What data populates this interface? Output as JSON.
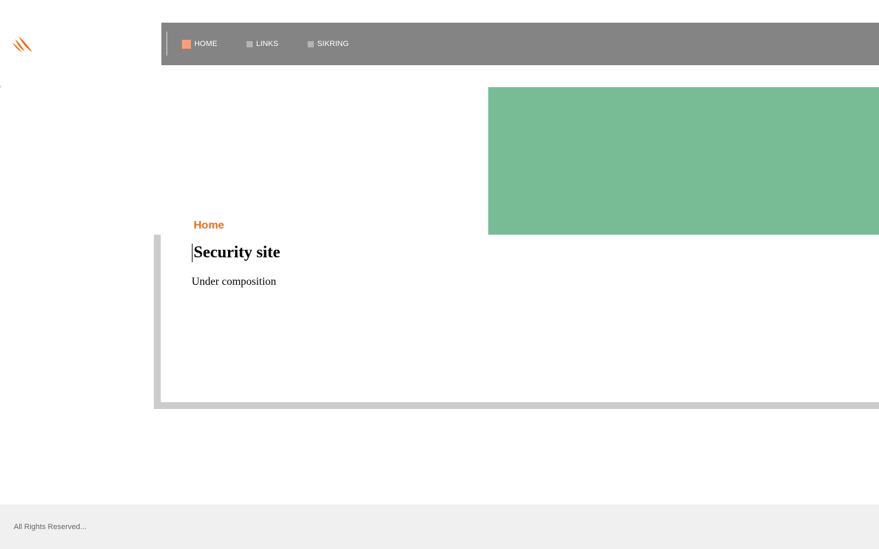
{
  "nav": {
    "items": [
      {
        "label": "HOME",
        "active": true
      },
      {
        "label": "LINKS",
        "active": false
      },
      {
        "label": "SIKRING",
        "active": false
      }
    ]
  },
  "main": {
    "section_title": "Home",
    "heading": "Security site",
    "body_text": "Under composition"
  },
  "footer": {
    "text": "All Rights Reserved..."
  },
  "colors": {
    "nav_background": "#848484",
    "accent_orange": "#f26b16",
    "active_bullet": "#fc9e7c",
    "banner_green": "#78bc96",
    "frame_gray": "#cccccc",
    "footer_background": "#f0f0f0"
  },
  "icons": {
    "logo": "orange-slash-logo-icon"
  }
}
